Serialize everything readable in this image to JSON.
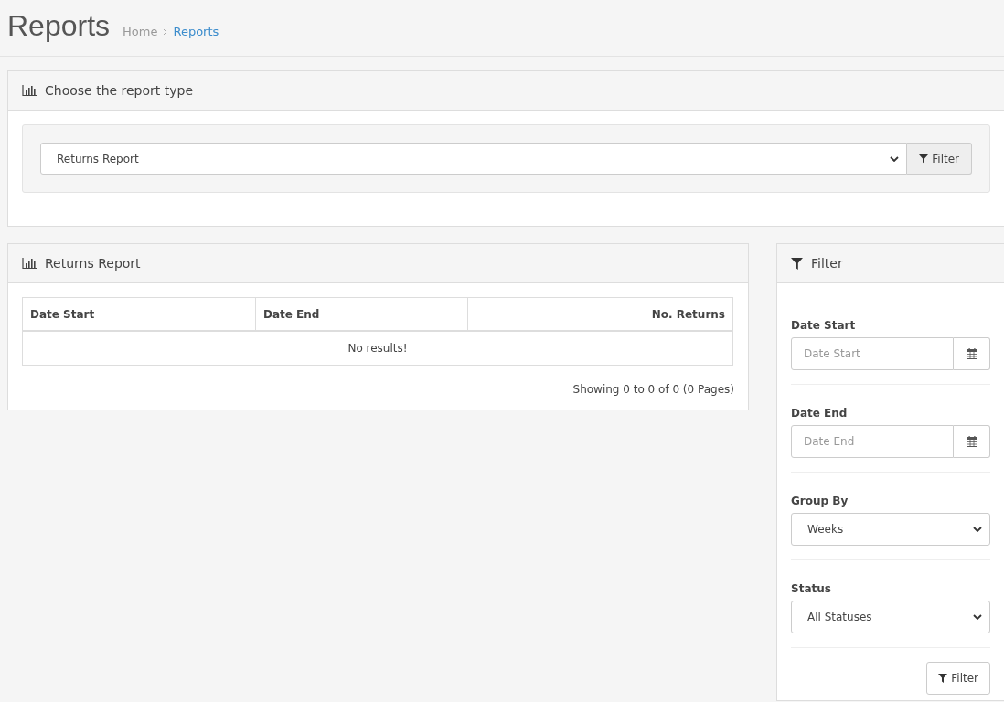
{
  "page_header": {
    "title": "Reports",
    "breadcrumb": [
      {
        "label": "Home",
        "selected": false
      },
      {
        "label": "Reports",
        "selected": true
      }
    ]
  },
  "report_type_panel": {
    "title": "Choose the report type",
    "select": {
      "value": "Returns Report"
    },
    "button": "Filter"
  },
  "report_panel": {
    "title": "Returns Report",
    "table": {
      "columns": [
        {
          "label": "Date Start",
          "right_aligned": false
        },
        {
          "label": "Date End",
          "right_aligned": false
        },
        {
          "label": "No. Returns",
          "right_aligned": true
        }
      ],
      "empty_message": "No results!"
    },
    "pagination_text": "Showing 0 to 0 of 0 (0 Pages)"
  },
  "filter_panel": {
    "title": "Filter",
    "fields": [
      {
        "kind": "date",
        "label": "Date Start",
        "placeholder": "Date Start"
      },
      {
        "kind": "date",
        "label": "Date End",
        "placeholder": "Date End"
      },
      {
        "kind": "select",
        "label": "Group By",
        "value": "Weeks"
      },
      {
        "kind": "select",
        "label": "Status",
        "value": "All Statuses"
      }
    ],
    "button": "Filter"
  }
}
